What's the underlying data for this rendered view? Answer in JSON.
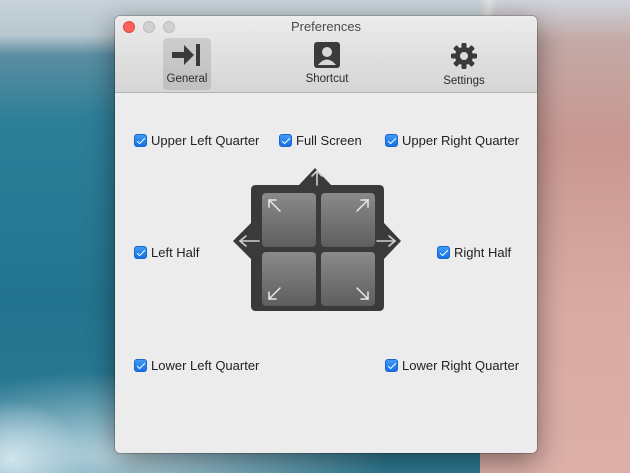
{
  "window": {
    "title": "Preferences"
  },
  "toolbar": {
    "tabs": [
      {
        "label": "General",
        "icon": "arrow-right-to-bar-icon",
        "active": true
      },
      {
        "label": "Shortcut",
        "icon": "person-square-icon",
        "active": false
      },
      {
        "label": "Settings",
        "icon": "gear-icon",
        "active": false
      }
    ]
  },
  "options": {
    "upper_left_quarter": {
      "label": "Upper Left Quarter",
      "checked": true
    },
    "full_screen": {
      "label": "Full Screen",
      "checked": true
    },
    "upper_right_quarter": {
      "label": "Upper Right Quarter",
      "checked": true
    },
    "left_half": {
      "label": "Left Half",
      "checked": true
    },
    "right_half": {
      "label": "Right Half",
      "checked": true
    },
    "lower_left_quarter": {
      "label": "Lower Left Quarter",
      "checked": true
    },
    "lower_right_quarter": {
      "label": "Lower Right Quarter",
      "checked": true
    }
  },
  "colors": {
    "checkbox_accent": "#1a7cf0",
    "close_button": "#fc615d",
    "pad_dark": "#3a3a3a"
  }
}
